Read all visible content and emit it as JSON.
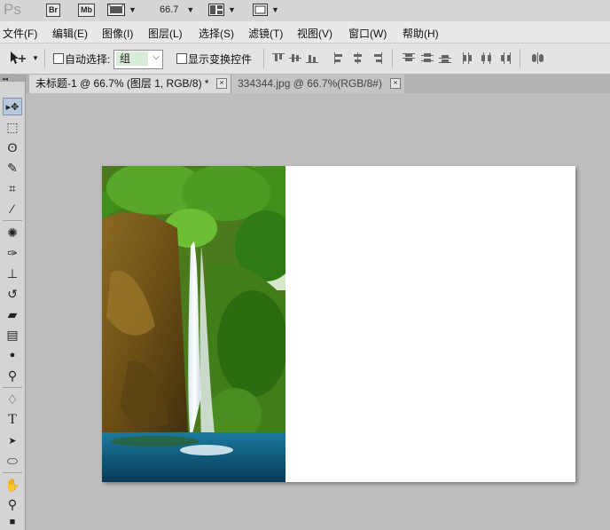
{
  "app": {
    "logo": "Ps",
    "bridge_label": "Br",
    "minibridge_label": "Mb",
    "zoom": "66.7"
  },
  "menu": [
    "文件(F)",
    "编辑(E)",
    "图像(I)",
    "图层(L)",
    "选择(S)",
    "滤镜(T)",
    "视图(V)",
    "窗口(W)",
    "帮助(H)"
  ],
  "options": {
    "auto_select_label": "自动选择:",
    "auto_select_value": "组",
    "show_transform_label": "显示变换控件"
  },
  "tabs": [
    {
      "label": "未标题-1 @ 66.7% (图层 1, RGB/8) *",
      "active": true
    },
    {
      "label": "334344.jpg @ 66.7%(RGB/8#)",
      "active": false
    }
  ],
  "close_glyph": "×",
  "tools": [
    {
      "name": "move-tool",
      "glyph": "▸✥"
    },
    {
      "name": "marquee-tool",
      "glyph": "⬚"
    },
    {
      "name": "lasso-tool",
      "glyph": "ʘ"
    },
    {
      "name": "quick-select-tool",
      "glyph": "✎"
    },
    {
      "name": "crop-tool",
      "glyph": "⌗"
    },
    {
      "name": "eyedropper-tool",
      "glyph": "⁄"
    },
    {
      "name": "healing-tool",
      "glyph": "✺"
    },
    {
      "name": "brush-tool",
      "glyph": "✑"
    },
    {
      "name": "stamp-tool",
      "glyph": "⊥"
    },
    {
      "name": "history-brush-tool",
      "glyph": "↺"
    },
    {
      "name": "eraser-tool",
      "glyph": "▰"
    },
    {
      "name": "gradient-tool",
      "glyph": "▤"
    },
    {
      "name": "blur-tool",
      "glyph": "●"
    },
    {
      "name": "dodge-tool",
      "glyph": "⚲"
    },
    {
      "name": "pen-tool",
      "glyph": "♢"
    },
    {
      "name": "type-tool",
      "glyph": "T"
    },
    {
      "name": "path-select-tool",
      "glyph": "➤"
    },
    {
      "name": "shape-tool",
      "glyph": "⬭"
    },
    {
      "name": "hand-tool",
      "glyph": "✋"
    },
    {
      "name": "zoom-tool",
      "glyph": "⚲"
    },
    {
      "name": "color-swatches",
      "glyph": "■"
    }
  ],
  "colors": {
    "workspace": "#bdbdbd",
    "active_tool_bg": "#b9c9dd"
  }
}
